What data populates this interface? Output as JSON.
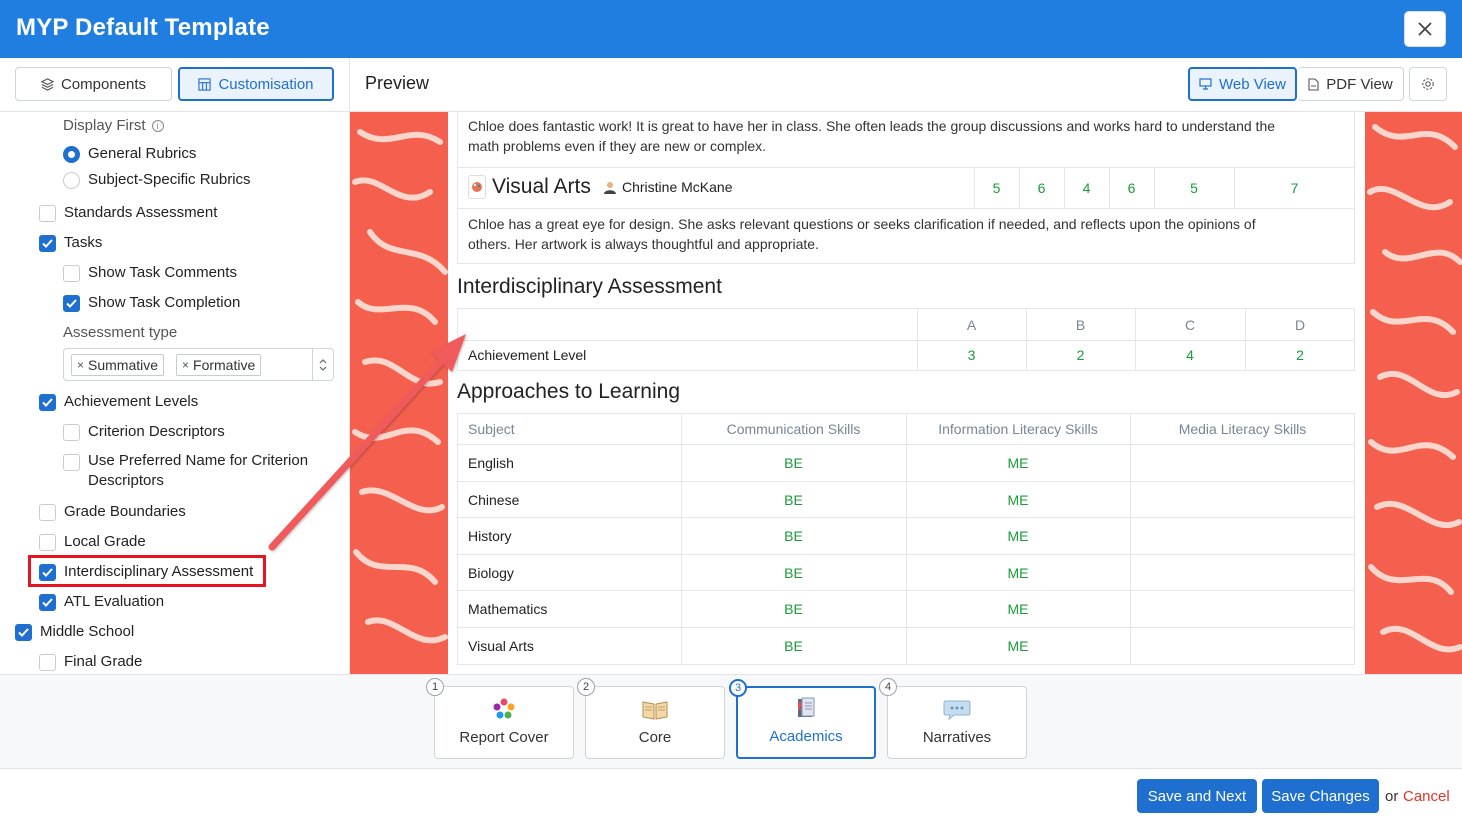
{
  "window": {
    "title": "MYP Default Template"
  },
  "left_tabs": {
    "components": "Components",
    "customisation": "Customisation"
  },
  "options": {
    "display_first": "Display First",
    "general_rubrics": "General Rubrics",
    "subject_rubrics": "Subject-Specific Rubrics",
    "standards_assessment": "Standards Assessment",
    "tasks": "Tasks",
    "show_task_comments": "Show Task Comments",
    "show_task_completion": "Show Task Completion",
    "assessment_type": "Assessment type",
    "chip_summative": "Summative",
    "chip_formative": "Formative",
    "achievement_levels": "Achievement Levels",
    "criterion_descriptors": "Criterion Descriptors",
    "preferred_name_1": "Use Preferred Name for Criterion",
    "preferred_name_2": "Descriptors",
    "grade_boundaries": "Grade Boundaries",
    "local_grade": "Local Grade",
    "interdisciplinary": "Interdisciplinary Assessment",
    "atl_evaluation": "ATL Evaluation",
    "middle_school": "Middle School",
    "final_grade": "Final Grade"
  },
  "preview": {
    "title": "Preview",
    "web_view": "Web View",
    "pdf_view": "PDF View"
  },
  "report": {
    "comment_top_1": "Chloe does fantastic work! It is great to have her in class. She often leads the group discussions and works hard to understand the",
    "comment_top_2": "math problems even if they are new or complex.",
    "subject_name": "Visual Arts",
    "teacher": "Christine McKane",
    "subject_scores": [
      "5",
      "6",
      "4",
      "6",
      "5",
      "7"
    ],
    "comment_va_1": "Chloe has a great eye for design. She asks relevant questions or seeks clarification if needed, and reflects upon the opinions of",
    "comment_va_2": "others. Her artwork is always thoughtful and appropriate.",
    "interdisciplinary_title": "Interdisciplinary Assessment",
    "criteria": [
      "A",
      "B",
      "C",
      "D"
    ],
    "achievement_label": "Achievement Level",
    "achievement_values": [
      "3",
      "2",
      "4",
      "2"
    ],
    "atl_title": "Approaches to Learning",
    "atl_headers": [
      "Subject",
      "Communication Skills",
      "Information Literacy Skills",
      "Media Literacy Skills"
    ],
    "atl_rows": [
      {
        "subject": "English",
        "comm": "BE",
        "info": "ME"
      },
      {
        "subject": "Chinese",
        "comm": "BE",
        "info": "ME"
      },
      {
        "subject": "History",
        "comm": "BE",
        "info": "ME"
      },
      {
        "subject": "Biology",
        "comm": "BE",
        "info": "ME"
      },
      {
        "subject": "Mathematics",
        "comm": "BE",
        "info": "ME"
      },
      {
        "subject": "Visual Arts",
        "comm": "BE",
        "info": "ME"
      }
    ]
  },
  "steps": [
    {
      "num": "1",
      "label": "Report Cover"
    },
    {
      "num": "2",
      "label": "Core"
    },
    {
      "num": "3",
      "label": "Academics"
    },
    {
      "num": "4",
      "label": "Narratives"
    }
  ],
  "footer": {
    "save_next": "Save and Next",
    "save_changes": "Save Changes",
    "or": "or",
    "cancel": "Cancel"
  },
  "colors": {
    "primary": "#1f6fd0",
    "header": "#1f7ee0",
    "highlight": "#e5141e",
    "score_green": "#1a9c3a",
    "pattern": "#f4604d"
  }
}
